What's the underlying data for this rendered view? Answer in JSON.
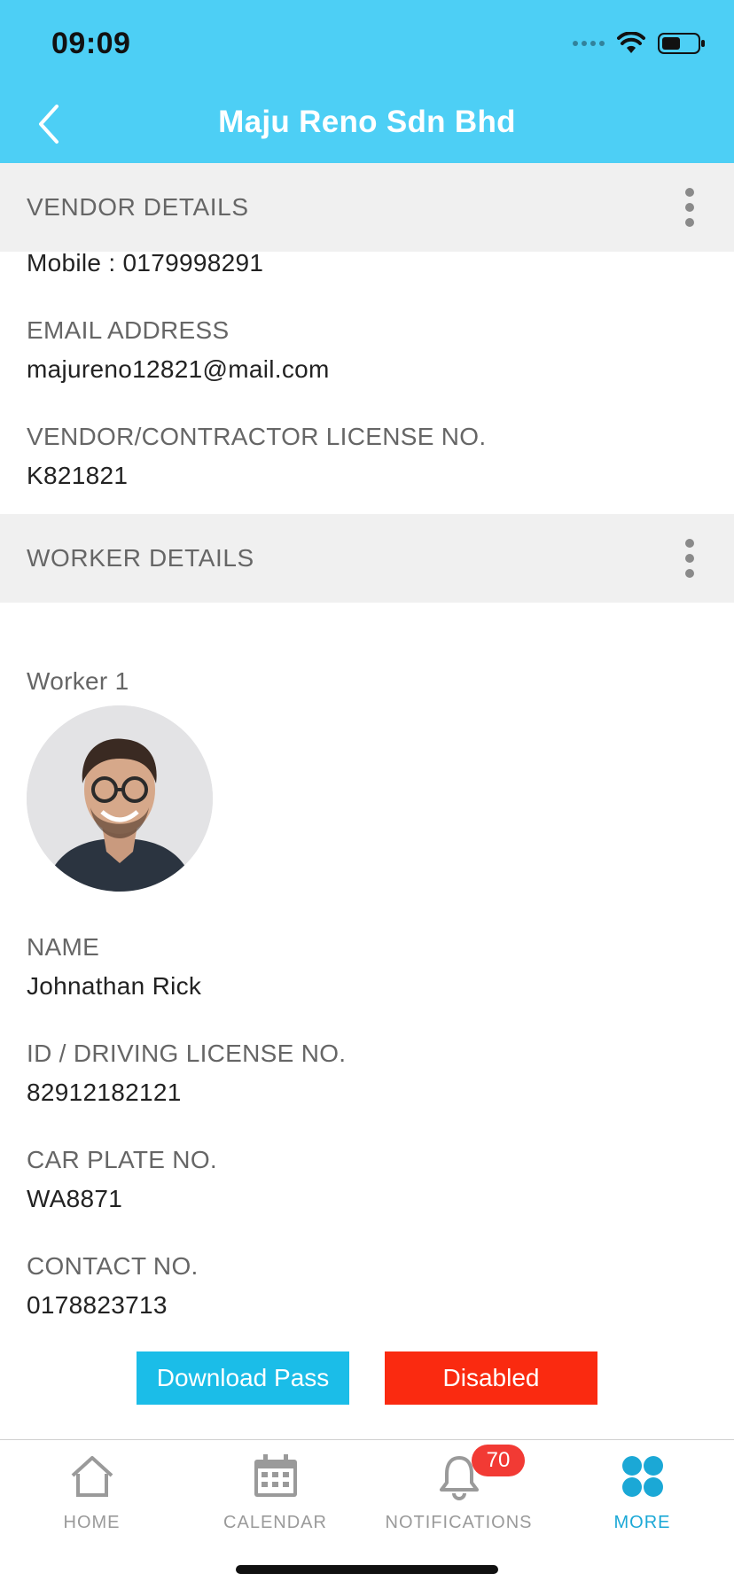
{
  "status_bar": {
    "time": "09:09"
  },
  "header": {
    "title": "Maju Reno Sdn Bhd"
  },
  "vendor_section": {
    "title": "VENDOR DETAILS",
    "mobile_line": "Mobile : 0179998291",
    "email_label": "EMAIL ADDRESS",
    "email_value": "majureno12821@mail.com",
    "license_label": "VENDOR/CONTRACTOR LICENSE NO.",
    "license_value": "K821821"
  },
  "worker_section": {
    "title": "WORKER DETAILS",
    "worker_title": "Worker 1",
    "name_label": "NAME",
    "name_value": "Johnathan Rick",
    "id_label": "ID / DRIVING LICENSE NO.",
    "id_value": "82912182121",
    "car_label": "CAR PLATE NO.",
    "car_value": "WA8871",
    "contact_label": "CONTACT NO.",
    "contact_value": "0178823713"
  },
  "actions": {
    "download_label": "Download Pass",
    "disabled_label": "Disabled"
  },
  "tabbar": {
    "home": "HOME",
    "calendar": "CALENDAR",
    "notifications": "NOTIFICATIONS",
    "notifications_badge": "70",
    "more": "MORE"
  },
  "colors": {
    "header": "#4dcff5",
    "download_button": "#1bbde8",
    "disabled_button": "#fa2a10",
    "active_tab": "#1ba8d6",
    "badge": "#f23a34"
  }
}
